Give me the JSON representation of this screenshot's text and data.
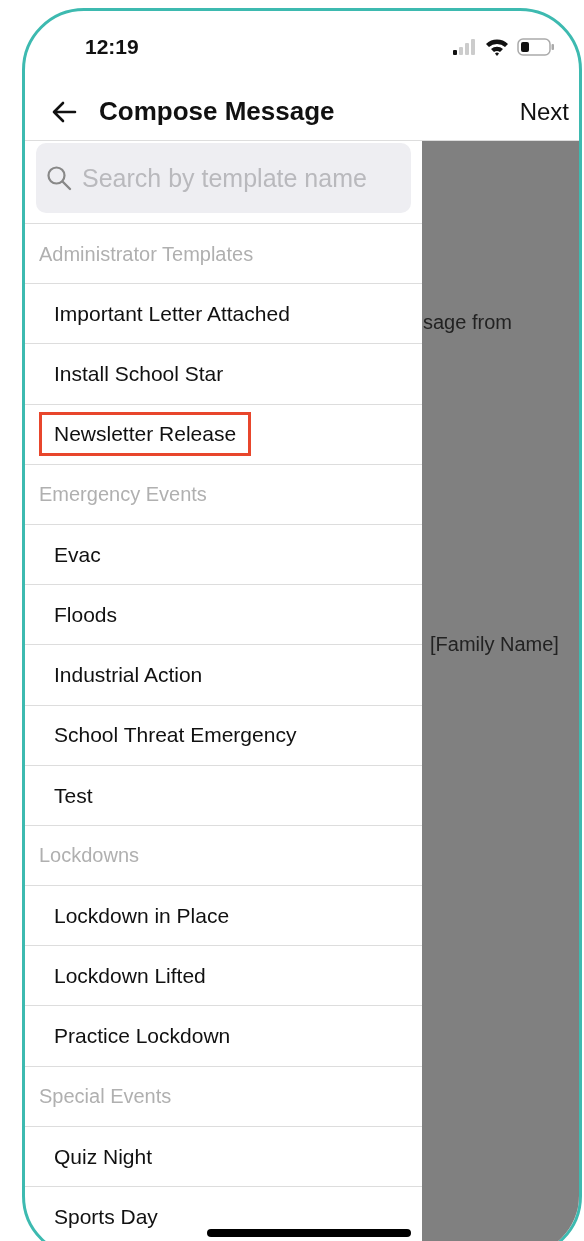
{
  "status_bar": {
    "time": "12:19"
  },
  "header": {
    "title": "Compose Message",
    "action": "Next"
  },
  "search": {
    "placeholder": "Search by template name"
  },
  "template_groups": [
    {
      "title": "Administrator Templates",
      "items": [
        {
          "label": "Important Letter Attached",
          "highlighted": false
        },
        {
          "label": "Install School Star",
          "highlighted": false
        },
        {
          "label": "Newsletter Release",
          "highlighted": true
        }
      ]
    },
    {
      "title": "Emergency Events",
      "items": [
        {
          "label": "Evac",
          "highlighted": false
        },
        {
          "label": "Floods",
          "highlighted": false
        },
        {
          "label": "Industrial Action",
          "highlighted": false
        },
        {
          "label": "School Threat Emergency",
          "highlighted": false
        },
        {
          "label": "Test",
          "highlighted": false
        }
      ]
    },
    {
      "title": "Lockdowns",
      "items": [
        {
          "label": "Lockdown in Place",
          "highlighted": false
        },
        {
          "label": "Lockdown Lifted",
          "highlighted": false
        },
        {
          "label": "Practice Lockdown",
          "highlighted": false
        }
      ]
    },
    {
      "title": "Special Events",
      "items": [
        {
          "label": "Quiz Night",
          "highlighted": false
        },
        {
          "label": "Sports Day",
          "highlighted": false
        }
      ]
    }
  ],
  "background_fragments": [
    "sage from",
    "[Family Name]"
  ]
}
